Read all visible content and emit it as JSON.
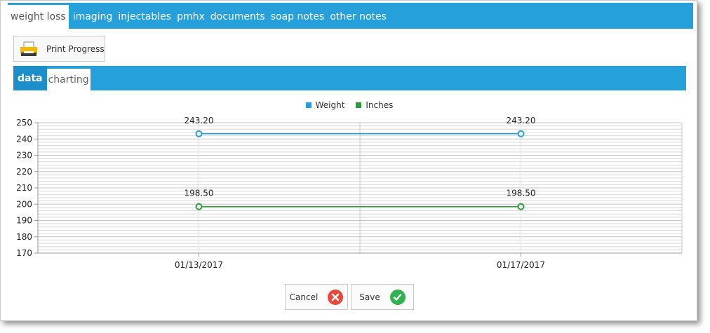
{
  "top_tabs": [
    {
      "label": "weight loss",
      "active": true
    },
    {
      "label": "imaging"
    },
    {
      "label": "injectables"
    },
    {
      "label": "pmhx"
    },
    {
      "label": "documents"
    },
    {
      "label": "soap notes"
    },
    {
      "label": "other notes"
    }
  ],
  "toolbar": {
    "print_label": "Print Progress",
    "print_icon": "printer-icon"
  },
  "sub_tabs": [
    {
      "label": "data"
    },
    {
      "label": "charting",
      "active": true
    }
  ],
  "chart_data": {
    "type": "line",
    "x": [
      "01/13/2017",
      "01/17/2017"
    ],
    "series": [
      {
        "name": "Weight",
        "values": [
          243.2,
          243.2
        ],
        "labels": [
          "243.20",
          "243.20"
        ],
        "color": "#26a0da"
      },
      {
        "name": "Inches",
        "values": [
          198.5,
          198.5
        ],
        "labels": [
          "198.50",
          "198.50"
        ],
        "color": "#2a9a3a"
      }
    ],
    "ylim": [
      170,
      250
    ],
    "yticks": [
      "250",
      "240",
      "230",
      "220",
      "210",
      "200",
      "190",
      "180",
      "170"
    ],
    "grid": true,
    "legend": "top-center"
  },
  "footer": {
    "cancel_label": "Cancel",
    "cancel_icon": "x-circle-icon",
    "cancel_color": "#e8473c",
    "save_label": "Save",
    "save_icon": "check-circle-icon",
    "save_color": "#2fb24f"
  }
}
